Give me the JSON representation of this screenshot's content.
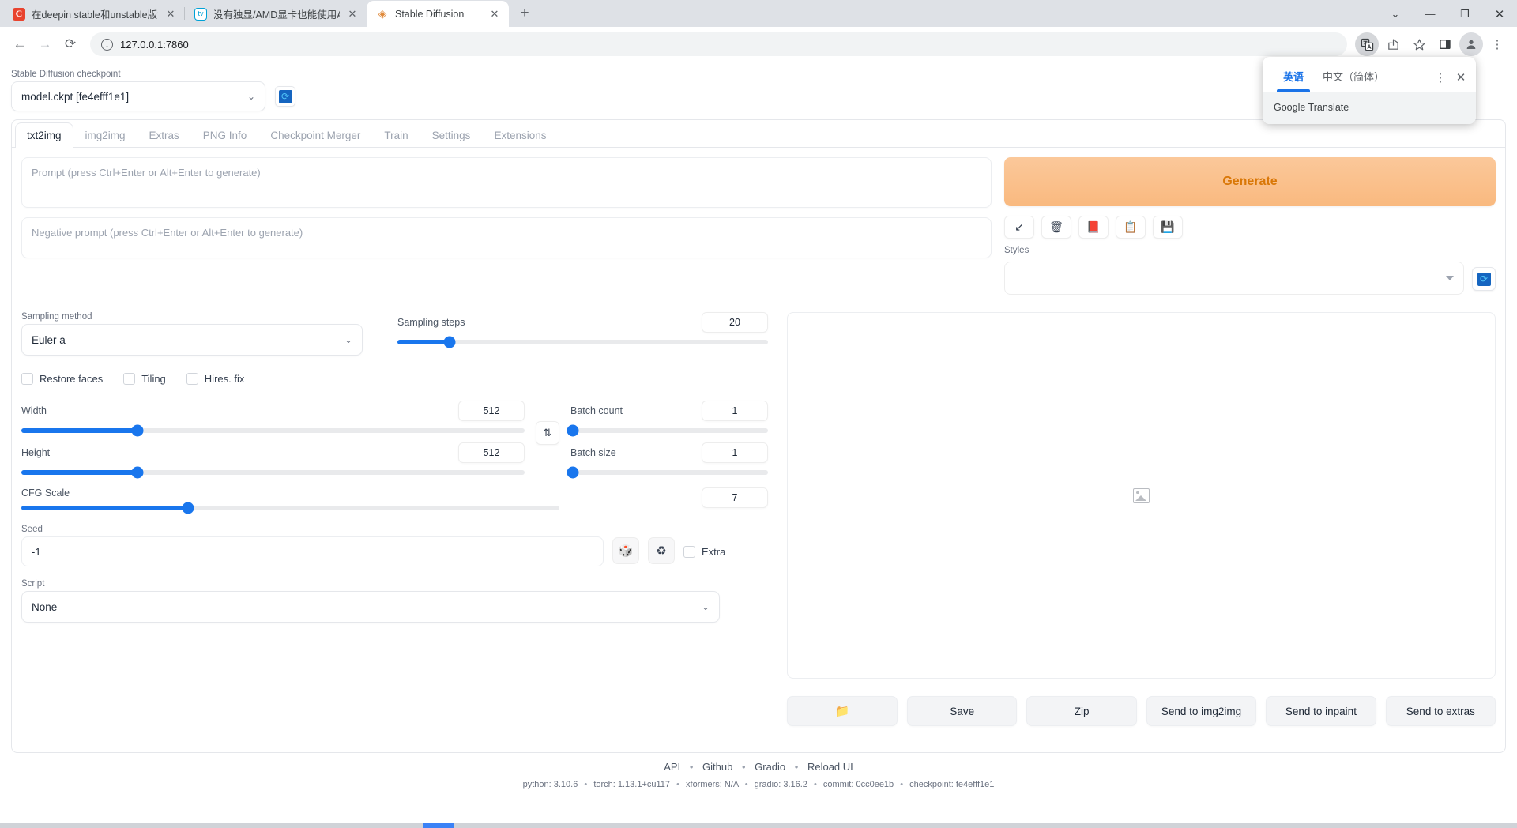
{
  "browser": {
    "tabs": [
      {
        "title": "在deepin stable和unstable版本",
        "favicon": "csdn-icon",
        "favicon_text": "C",
        "active": false
      },
      {
        "title": "没有独显/AMD显卡也能使用AI画",
        "favicon": "bilibili-icon",
        "favicon_text": "tv",
        "active": false
      },
      {
        "title": "Stable Diffusion",
        "favicon": "stable-diffusion-icon",
        "favicon_text": "◈",
        "active": true
      }
    ],
    "new_tab_label": "+",
    "window_controls": {
      "chevron": "⌄",
      "minimize": "—",
      "restore": "❐",
      "close": "✕"
    },
    "nav": {
      "back": "←",
      "forward": "→",
      "reload": "⟳"
    },
    "omnibox": {
      "value": "127.0.0.1:7860",
      "info_glyph": "i"
    },
    "toolbar_icons": [
      {
        "name": "translate-icon",
        "glyph": "文A",
        "active": true
      },
      {
        "name": "share-icon",
        "glyph": "⇪"
      },
      {
        "name": "bookmark-star-icon",
        "glyph": "☆"
      },
      {
        "name": "side-panel-icon",
        "glyph": "❑"
      },
      {
        "name": "profile-avatar-icon",
        "glyph": "●"
      },
      {
        "name": "more-menu-icon",
        "glyph": "⋮"
      }
    ]
  },
  "translate_popup": {
    "tabs": [
      {
        "label": "英语",
        "selected": true
      },
      {
        "label": "中文（简体）",
        "selected": false
      }
    ],
    "more_glyph": "⋮",
    "close_glyph": "✕",
    "footer": "Google Translate"
  },
  "sd": {
    "checkpoint": {
      "label": "Stable Diffusion checkpoint",
      "value": "model.ckpt [fe4efff1e1]",
      "chevron": "⌄",
      "refresh_glyph": "⟳"
    },
    "tabs": [
      {
        "label": "txt2img",
        "active": true
      },
      {
        "label": "img2img",
        "active": false
      },
      {
        "label": "Extras",
        "active": false
      },
      {
        "label": "PNG Info",
        "active": false
      },
      {
        "label": "Checkpoint Merger",
        "active": false
      },
      {
        "label": "Train",
        "active": false
      },
      {
        "label": "Settings",
        "active": false
      },
      {
        "label": "Extensions",
        "active": false
      }
    ],
    "prompt": {
      "placeholder": "Prompt (press Ctrl+Enter or Alt+Enter to generate)",
      "value": ""
    },
    "negative_prompt": {
      "placeholder": "Negative prompt (press Ctrl+Enter or Alt+Enter to generate)",
      "value": ""
    },
    "generate_button": "Generate",
    "tool_icons": [
      {
        "name": "arrow-down-left-icon",
        "glyph": "↙"
      },
      {
        "name": "trash-icon",
        "glyph": "🗑"
      },
      {
        "name": "card-index-icon",
        "glyph": "📕"
      },
      {
        "name": "clipboard-icon",
        "glyph": "📋"
      },
      {
        "name": "floppy-save-icon",
        "glyph": "💾"
      }
    ],
    "styles": {
      "label": "Styles",
      "value": "",
      "refresh_glyph": "⟳"
    },
    "sampling_method": {
      "label": "Sampling method",
      "value": "Euler a",
      "chevron": "⌄"
    },
    "sampling_steps": {
      "label": "Sampling steps",
      "value": "20",
      "percent": 14
    },
    "checkboxes": [
      {
        "label": "Restore faces",
        "checked": false
      },
      {
        "label": "Tiling",
        "checked": false
      },
      {
        "label": "Hires. fix",
        "checked": false
      }
    ],
    "width": {
      "label": "Width",
      "value": "512",
      "percent": 23
    },
    "height": {
      "label": "Height",
      "value": "512",
      "percent": 23
    },
    "cfg_scale": {
      "label": "CFG Scale",
      "value": "7",
      "percent": 31
    },
    "swap_glyph": "⇅",
    "batch_count": {
      "label": "Batch count",
      "value": "1",
      "percent": 0
    },
    "batch_size": {
      "label": "Batch size",
      "value": "1",
      "percent": 0
    },
    "seed": {
      "label": "Seed",
      "value": "-1",
      "dice_glyph": "🎲",
      "recycle_glyph": "♻",
      "extra_label": "Extra",
      "extra_checked": false
    },
    "script": {
      "label": "Script",
      "value": "None",
      "chevron": "⌄"
    },
    "gallery": {
      "placeholder_icon": "image-placeholder-icon"
    },
    "action_buttons": [
      {
        "name": "open-folder-button",
        "label": "📁"
      },
      {
        "name": "save-button",
        "label": "Save"
      },
      {
        "name": "zip-button",
        "label": "Zip"
      },
      {
        "name": "send-to-img2img-button",
        "label": "Send to img2img"
      },
      {
        "name": "send-to-inpaint-button",
        "label": "Send to inpaint"
      },
      {
        "name": "send-to-extras-button",
        "label": "Send to extras"
      }
    ],
    "footer": {
      "links": [
        "API",
        "Github",
        "Gradio",
        "Reload UI"
      ],
      "separator": "•",
      "meta": [
        "python: 3.10.6",
        "torch: 1.13.1+cu117",
        "xformers: N/A",
        "gradio: 3.16.2",
        "commit: 0cc0ee1b",
        "checkpoint: fe4efff1e1"
      ]
    }
  },
  "colors": {
    "accent_blue": "#1976ed",
    "generate_orange": "#d97706",
    "chrome_bg": "#dee1e6"
  }
}
